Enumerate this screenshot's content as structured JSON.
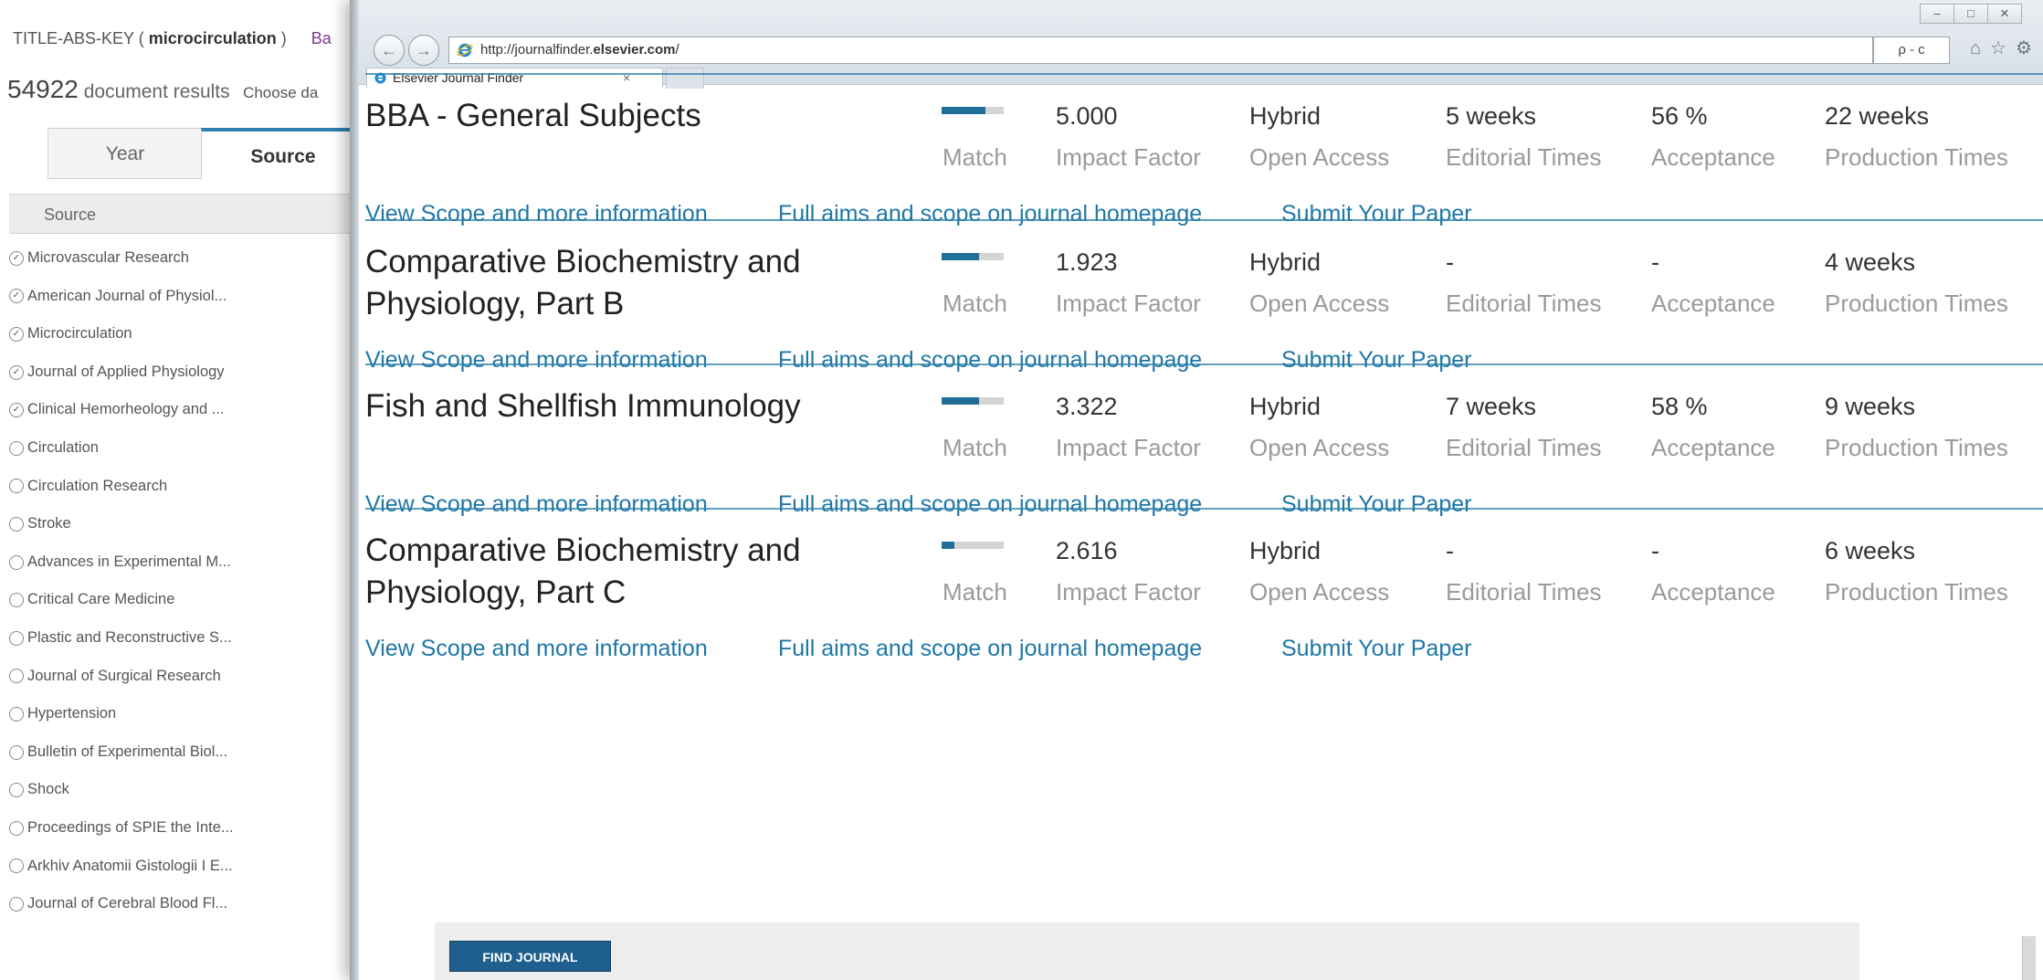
{
  "background_window": {
    "query_prefix": "TITLE-ABS-KEY ( ",
    "query_keyword": "microcirculation",
    "query_suffix": " )",
    "back_link": "Ba",
    "results_count": "54922",
    "results_label": " document results",
    "choose_text": "Choose da",
    "tabs": [
      "Year",
      "Source"
    ],
    "active_tab": "Source",
    "source_header": "Source",
    "sources": [
      {
        "label": "Microvascular Research",
        "checked": true
      },
      {
        "label": "American Journal of Physiol...",
        "checked": true
      },
      {
        "label": "Microcirculation",
        "checked": true
      },
      {
        "label": "Journal of Applied Physiology",
        "checked": true
      },
      {
        "label": "Clinical Hemorheology and ...",
        "checked": true
      },
      {
        "label": "Circulation",
        "checked": false
      },
      {
        "label": "Circulation Research",
        "checked": false
      },
      {
        "label": "Stroke",
        "checked": false
      },
      {
        "label": "Advances in Experimental M...",
        "checked": false
      },
      {
        "label": "Critical Care Medicine",
        "checked": false
      },
      {
        "label": "Plastic and Reconstructive S...",
        "checked": false
      },
      {
        "label": "Journal of Surgical Research",
        "checked": false
      },
      {
        "label": "Hypertension",
        "checked": false
      },
      {
        "label": "Bulletin of Experimental Biol...",
        "checked": false
      },
      {
        "label": "Shock",
        "checked": false
      },
      {
        "label": "Proceedings of SPIE the Inte...",
        "checked": false
      },
      {
        "label": "Arkhiv Anatomii Gistologii I E...",
        "checked": false
      },
      {
        "label": "Journal of Cerebral Blood Fl...",
        "checked": false
      }
    ]
  },
  "browser": {
    "url_prefix": "http://journalfinder.",
    "url_host": "elsevier.com",
    "url_suffix": "/",
    "address_controls": "ρ - c",
    "tab_title": "Elsevier Journal Finder",
    "tab_close": "×",
    "window_controls": [
      "–",
      "□",
      "✕"
    ],
    "toolbar_icons": [
      "home-icon",
      "star-icon",
      "gear-icon"
    ]
  },
  "labels": {
    "match": "Match",
    "impact_factor": "Impact Factor",
    "open_access": "Open Access",
    "editorial_times": "Editorial Times",
    "acceptance": "Acceptance",
    "production_times": "Production Times"
  },
  "links": {
    "scope": "View Scope and more information",
    "aims": "Full aims and scope on journal homepage",
    "submit": "Submit Your Paper"
  },
  "journals": [
    {
      "title": "BBA - General Subjects",
      "match": 0.7,
      "impact_factor": "5.000",
      "open_access": "Hybrid",
      "editorial_times": "5 weeks",
      "acceptance": "56 %",
      "production_times": "22 weeks"
    },
    {
      "title": "Comparative Biochemistry and Physiology, Part B",
      "match": 0.6,
      "impact_factor": "1.923",
      "open_access": "Hybrid",
      "editorial_times": "-",
      "acceptance": "-",
      "production_times": "4 weeks"
    },
    {
      "title": "Fish and Shellfish Immunology",
      "match": 0.6,
      "impact_factor": "3.322",
      "open_access": "Hybrid",
      "editorial_times": "7 weeks",
      "acceptance": "58 %",
      "production_times": "9 weeks"
    },
    {
      "title": "Comparative Biochemistry and Physiology, Part C",
      "match": 0.2,
      "impact_factor": "2.616",
      "open_access": "Hybrid",
      "editorial_times": "-",
      "acceptance": "-",
      "production_times": "6 weeks"
    }
  ],
  "find_journal_button": "FIND JOURNAL",
  "colors": {
    "accent": "#1e77a6",
    "rule": "#2a7fa6",
    "match_fill": "#1f6f99",
    "button": "#1e5f8e"
  }
}
